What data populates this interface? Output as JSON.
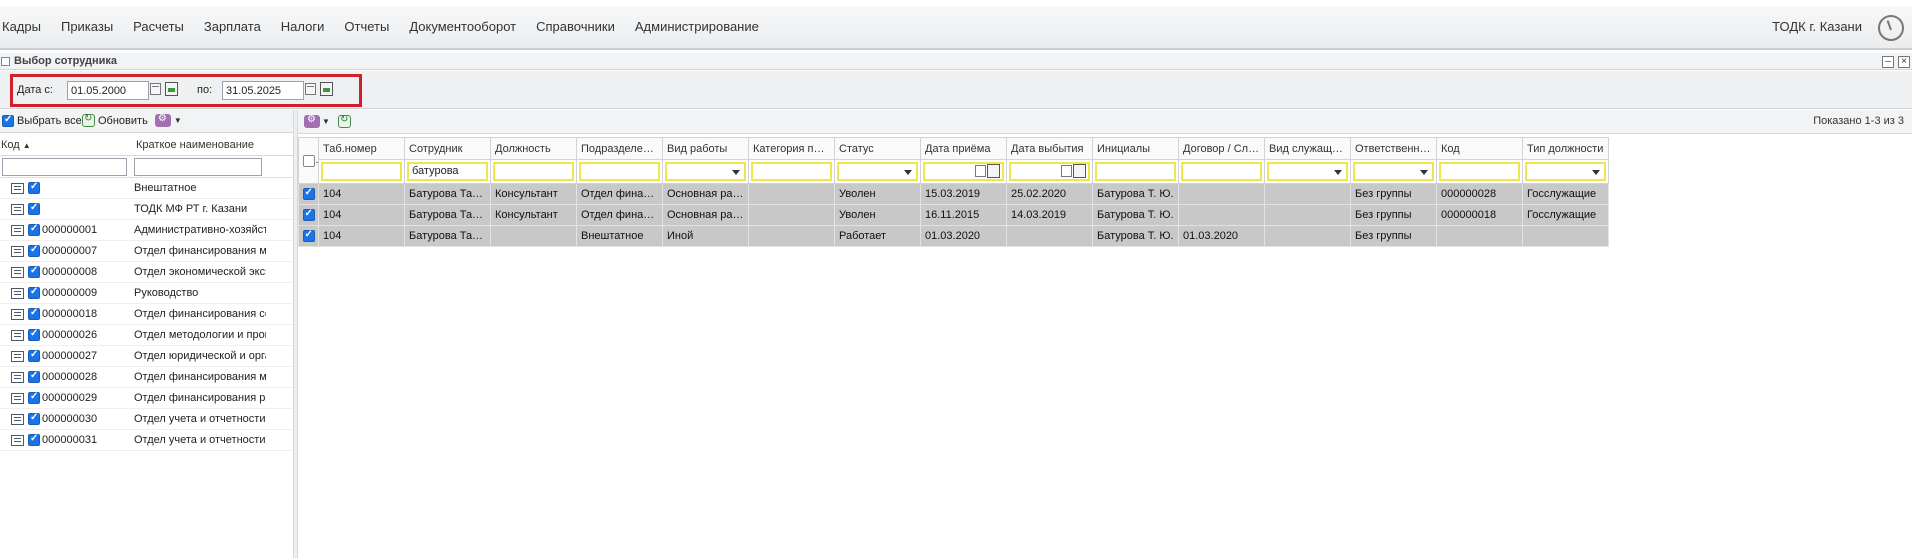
{
  "top_menu": {
    "items": [
      "Кадры",
      "Приказы",
      "Расчеты",
      "Зарплата",
      "Налоги",
      "Отчеты",
      "Документооборот",
      "Справочники",
      "Администрирование"
    ],
    "org": "ТОДК г. Казани"
  },
  "window": {
    "title": "Выбор сотрудника",
    "minimize": "–",
    "close": "×"
  },
  "date_filter": {
    "from_label": "Дата с:",
    "from_value": "01.05.2000",
    "to_label": "по:",
    "to_value": "31.05.2025"
  },
  "left_panel": {
    "select_all_label": "Выбрать все",
    "refresh_label": "Обновить",
    "col_code": "Код",
    "col_name": "Краткое наименование",
    "rows": [
      {
        "code": "",
        "name": "Внештатное"
      },
      {
        "code": "",
        "name": "ТОДК МФ РТ г. Казани"
      },
      {
        "code": "000000001",
        "name": "Административно-хозяйственный отдел"
      },
      {
        "code": "000000007",
        "name": "Отдел финансирования межбюджетных отношений"
      },
      {
        "code": "000000008",
        "name": "Отдел экономической экспертизы"
      },
      {
        "code": "000000009",
        "name": "Руководство"
      },
      {
        "code": "000000018",
        "name": "Отдел финансирования социальной сферы"
      },
      {
        "code": "000000026",
        "name": "Отдел методологии и процедур"
      },
      {
        "code": "000000027",
        "name": "Отдел юридической и организационной работы"
      },
      {
        "code": "000000028",
        "name": "Отдел финансирования муниципальных"
      },
      {
        "code": "000000029",
        "name": "Отдел финансирования расходов"
      },
      {
        "code": "000000030",
        "name": "Отдел учета и отчетности"
      },
      {
        "code": "000000031",
        "name": "Отдел учета и отчетности"
      }
    ]
  },
  "grid": {
    "shown_text": "Показано 1-3 из 3",
    "columns": [
      "Таб.номер",
      "Сотрудник",
      "Должность",
      "Подразделение",
      "Вид работы",
      "Категория персо...",
      "Статус",
      "Дата приёма",
      "Дата выбытия",
      "Инициалы",
      "Договор / Служе...",
      "Вид служащего",
      "Ответственный ...",
      "Код",
      "Тип должности"
    ],
    "filter_employee": "батурова",
    "rows": [
      [
        "104",
        "Батурова Татьян...",
        "Консультант",
        "Отдел финансир...",
        "Основная работа",
        "",
        "Уволен",
        "15.03.2019",
        "25.02.2020",
        "Батурова Т. Ю.",
        "",
        "",
        "Без группы",
        "000000028",
        "Госслужащие"
      ],
      [
        "104",
        "Батурова Татьян...",
        "Консультант",
        "Отдел финансир...",
        "Основная работа",
        "",
        "Уволен",
        "16.11.2015",
        "14.03.2019",
        "Батурова Т. Ю.",
        "",
        "",
        "Без группы",
        "000000018",
        "Госслужащие"
      ],
      [
        "104",
        "Батурова Татьян...",
        "",
        "Внештатное",
        "Иной",
        "",
        "Работает",
        "01.03.2020",
        "",
        "Батурова Т. Ю.",
        "01.03.2020",
        "",
        "Без группы",
        "",
        ""
      ]
    ]
  }
}
